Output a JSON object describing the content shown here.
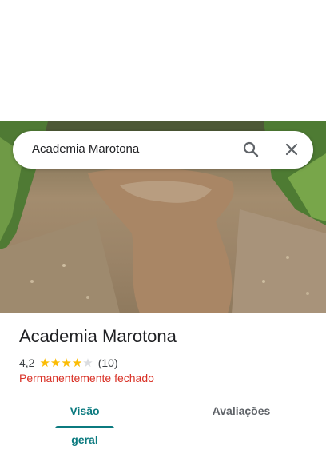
{
  "search": {
    "query": "Academia Marotona"
  },
  "place": {
    "name": "Academia Marotona",
    "rating": "4,2",
    "rating_value": 4.2,
    "star_count": 5,
    "review_count": "(10)",
    "status": "Permanentemente fechado"
  },
  "tabs": {
    "overview": "Visão geral",
    "reviews": "Avaliações"
  },
  "icons": {
    "search": "search-icon",
    "close": "close-icon",
    "star": "star-icon"
  },
  "colors": {
    "accent": "#0b7a7f",
    "closed_status": "#d93025",
    "star": "#fbbc04"
  }
}
